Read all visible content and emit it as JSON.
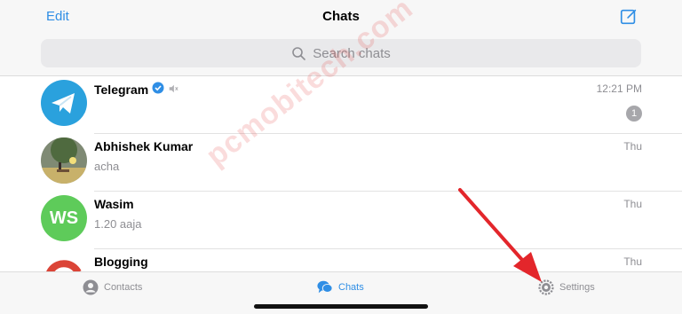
{
  "header": {
    "edit_label": "Edit",
    "title": "Chats",
    "compose_icon": "compose-icon"
  },
  "search": {
    "placeholder": "Search chats",
    "icon": "search-icon"
  },
  "chats": [
    {
      "name": "Telegram",
      "verified": true,
      "muted": true,
      "preview": "",
      "time": "12:21 PM",
      "unread": "1",
      "avatar": "telegram-logo"
    },
    {
      "name": "Abhishek Kumar",
      "preview": "acha",
      "time": "Thu",
      "avatar": "photo-landscape"
    },
    {
      "name": "Wasim",
      "preview": "1.20 aaja",
      "time": "Thu",
      "avatar_initials": "WS",
      "avatar_color": "#5ecb5a"
    },
    {
      "name": "Blogging",
      "preview": "",
      "time": "Thu",
      "avatar": "google-logo"
    }
  ],
  "tabbar": {
    "contacts_label": "Contacts",
    "chats_label": "Chats",
    "settings_label": "Settings"
  },
  "watermark": "pcmobitech.com",
  "colors": {
    "accent": "#2f8ee5",
    "annotation_arrow": "#e3262b",
    "wasim_avatar": "#5ecb5a"
  }
}
